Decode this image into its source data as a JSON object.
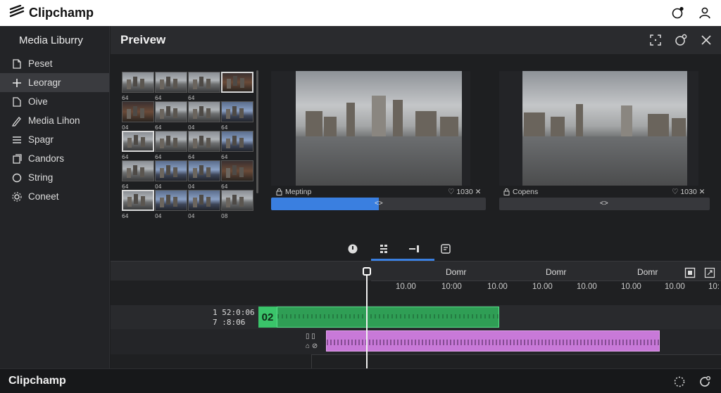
{
  "app": {
    "title": "Clipchamp"
  },
  "sidebar": {
    "title": "Media Liburry",
    "items": [
      {
        "label": "Peset",
        "icon": "doc-plus-icon"
      },
      {
        "label": "Leoragr",
        "icon": "plus-icon"
      },
      {
        "label": "Oive",
        "icon": "file-icon"
      },
      {
        "label": "Media Lihon",
        "icon": "pen-icon"
      },
      {
        "label": "Spagr",
        "icon": "list-icon"
      },
      {
        "label": "Candors",
        "icon": "copy-icon"
      },
      {
        "label": "String",
        "icon": "ring-icon"
      },
      {
        "label": "Coneet",
        "icon": "gear-icon"
      }
    ]
  },
  "preview": {
    "title": "Preivew",
    "left_pane": {
      "label": "Meptinp",
      "value": "1030",
      "progress": 0.5
    },
    "right_pane": {
      "label": "Copens",
      "value": "1030"
    }
  },
  "thumbs": [
    [
      "64",
      "64",
      "64",
      ""
    ],
    [
      "04",
      "64",
      "04",
      "64"
    ],
    [
      "64",
      "64",
      "64",
      "64"
    ],
    [
      "64",
      "04",
      "04",
      "64"
    ],
    [
      "64",
      "04",
      "04",
      "08"
    ]
  ],
  "timeline": {
    "ruler_labels": [
      "Domr",
      "Domr",
      "Domr"
    ],
    "ticks": [
      "10.00",
      "10:00",
      "10.00",
      "10.00",
      "10.00",
      "10.00",
      "10.00",
      "10:"
    ],
    "track_times": [
      "1 52:0:06",
      "7 :8:06"
    ],
    "clip_number": "02"
  },
  "bottom": {
    "brand": "Clipchamp"
  }
}
